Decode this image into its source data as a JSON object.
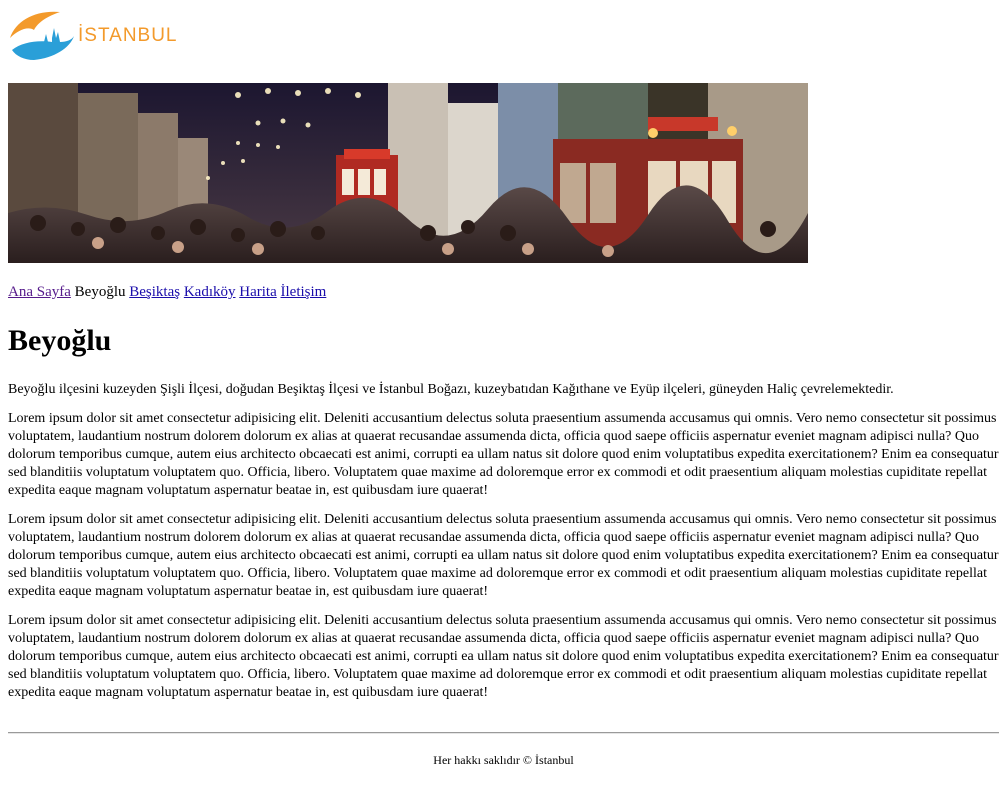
{
  "logo": {
    "text": "İSTANBUL",
    "icon": "istanbul-logo-icon",
    "colors": {
      "orange": "#f39a2b",
      "blue": "#2a9fd8"
    }
  },
  "banner": {
    "description_icon": "istiklal-street-tram-photo"
  },
  "nav": {
    "items": [
      {
        "label": "Ana Sayfa",
        "link": true,
        "visited": true
      },
      {
        "label": "Beyoğlu",
        "link": false,
        "visited": false
      },
      {
        "label": "Beşiktaş",
        "link": true,
        "visited": false
      },
      {
        "label": "Kadıköy",
        "link": true,
        "visited": false
      },
      {
        "label": "Harita",
        "link": true,
        "visited": false
      },
      {
        "label": "İletişim",
        "link": true,
        "visited": false
      }
    ]
  },
  "main": {
    "title": "Beyoğlu",
    "paragraphs": [
      "Beyoğlu ilçesini kuzeyden Şişli İlçesi, doğudan Beşiktaş İlçesi ve İstanbul Boğazı, kuzeybatıdan Kağıthane ve Eyüp ilçeleri, güneyden Haliç çevrelemektedir.",
      "Lorem ipsum dolor sit amet consectetur adipisicing elit. Deleniti accusantium delectus soluta praesentium assumenda accusamus qui omnis. Vero nemo consectetur sit possimus voluptatem, laudantium nostrum dolorem dolorum ex alias at quaerat recusandae assumenda dicta, officia quod saepe officiis aspernatur eveniet magnam adipisci nulla? Quo dolorum temporibus cumque, autem eius architecto obcaecati est animi, corrupti ea ullam natus sit dolore quod enim voluptatibus expedita exercitationem? Enim ea consequatur sed blanditiis voluptatum voluptatem quo. Officia, libero. Voluptatem quae maxime ad doloremque error ex commodi et odit praesentium aliquam molestias cupiditate repellat expedita eaque magnam voluptatum aspernatur beatae in, est quibusdam iure quaerat!",
      "Lorem ipsum dolor sit amet consectetur adipisicing elit. Deleniti accusantium delectus soluta praesentium assumenda accusamus qui omnis. Vero nemo consectetur sit possimus voluptatem, laudantium nostrum dolorem dolorum ex alias at quaerat recusandae assumenda dicta, officia quod saepe officiis aspernatur eveniet magnam adipisci nulla? Quo dolorum temporibus cumque, autem eius architecto obcaecati est animi, corrupti ea ullam natus sit dolore quod enim voluptatibus expedita exercitationem? Enim ea consequatur sed blanditiis voluptatum voluptatem quo. Officia, libero. Voluptatem quae maxime ad doloremque error ex commodi et odit praesentium aliquam molestias cupiditate repellat expedita eaque magnam voluptatum aspernatur beatae in, est quibusdam iure quaerat!",
      "Lorem ipsum dolor sit amet consectetur adipisicing elit. Deleniti accusantium delectus soluta praesentium assumenda accusamus qui omnis. Vero nemo consectetur sit possimus voluptatem, laudantium nostrum dolorem dolorum ex alias at quaerat recusandae assumenda dicta, officia quod saepe officiis aspernatur eveniet magnam adipisci nulla? Quo dolorum temporibus cumque, autem eius architecto obcaecati est animi, corrupti ea ullam natus sit dolore quod enim voluptatibus expedita exercitationem? Enim ea consequatur sed blanditiis voluptatum voluptatem quo. Officia, libero. Voluptatem quae maxime ad doloremque error ex commodi et odit praesentium aliquam molestias cupiditate repellat expedita eaque magnam voluptatum aspernatur beatae in, est quibusdam iure quaerat!"
    ]
  },
  "footer": {
    "text": "Her hakkı saklıdır © İstanbul"
  }
}
